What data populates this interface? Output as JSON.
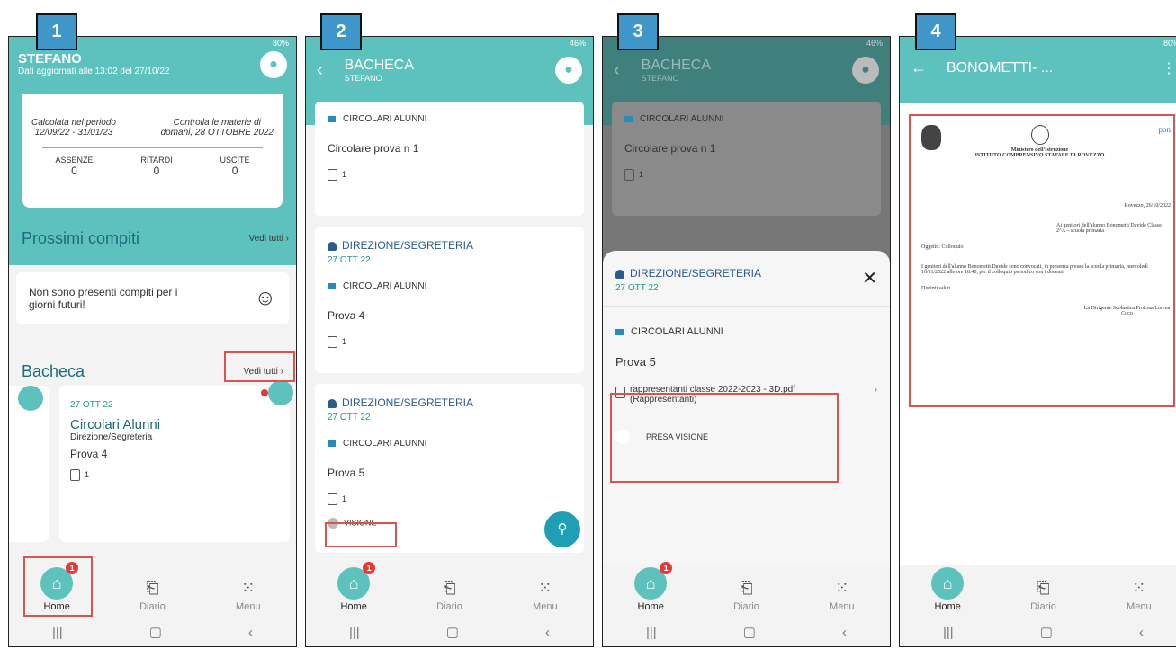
{
  "steps": [
    "1",
    "2",
    "3",
    "4"
  ],
  "status": {
    "battery1": "80%",
    "battery2": "46%"
  },
  "nav": {
    "home": "Home",
    "diario": "Diario",
    "menu": "Menu",
    "badge": "1"
  },
  "p1": {
    "title": "STEFANO",
    "subtitle": "Dati aggiornati alle 13:02 del 27/10/22",
    "calc": "Calcolata nel periodo",
    "calc_dates": "12/09/22 - 31/01/23",
    "check": "Controlla le materie di",
    "check_date": "domani, 28 OTTOBRE 2022",
    "stats": [
      {
        "label": "ASSENZE",
        "value": "0"
      },
      {
        "label": "RITARDI",
        "value": "0"
      },
      {
        "label": "USCITE",
        "value": "0"
      }
    ],
    "compiti_title": "Prossimi compiti",
    "see_all": "Vedi tutti ›",
    "empty_tasks": "Non sono presenti compiti per i giorni futuri!",
    "bacheca_title": "Bacheca",
    "card_date": "27 OTT 22",
    "card_title": "Circolari Alunni",
    "card_sub": "Direzione/Segreteria",
    "card_item": "Prova 4",
    "card_count": "1"
  },
  "p2": {
    "title": "BACHECA",
    "subtitle": "STEFANO",
    "category": "CIRCOLARI ALUNNI",
    "card1_title": "Circolare prova n 1",
    "sender": "DIREZIONE/SEGRETERIA",
    "date": "27 OTT 22",
    "card2_title": "Prova 4",
    "card3_title": "Prova 5",
    "count": "1",
    "visione": "VISIONE"
  },
  "p3": {
    "sender": "DIREZIONE/SEGRETERIA",
    "date": "27 OTT 22",
    "category": "CIRCOLARI ALUNNI",
    "title": "Prova 5",
    "attachment": "rappresentanti classe 2022-2023 - 3D.pdf (Rappresentanti)",
    "presa": "PRESA VISIONE"
  },
  "p4": {
    "title": "BONOMETTI- ...",
    "doc_ministry": "Ministero dell'Istruzione",
    "doc_school": "ISTITUTO COMPRENSIVO STATALE DI ROVEZZO",
    "doc_date": "Rovezzo, 26/10/2022",
    "doc_to": "Ai genitori dell'alunno Bonometti Davide Classe 2^A – scuola primaria",
    "doc_subject": "Oggetto: Colloquio",
    "doc_body": "I genitori dell'alunno Bonometti Davide sono convocati, in presenza presso la scuola primaria, mercoledì 16/11/2022 alle ore 18.40, per il colloquio periodico con i docenti.",
    "doc_greet": "Distinti saluti",
    "doc_sign": "La Dirigente Scolastica Prof.ssa Lorena Coco",
    "pon": "pon"
  }
}
